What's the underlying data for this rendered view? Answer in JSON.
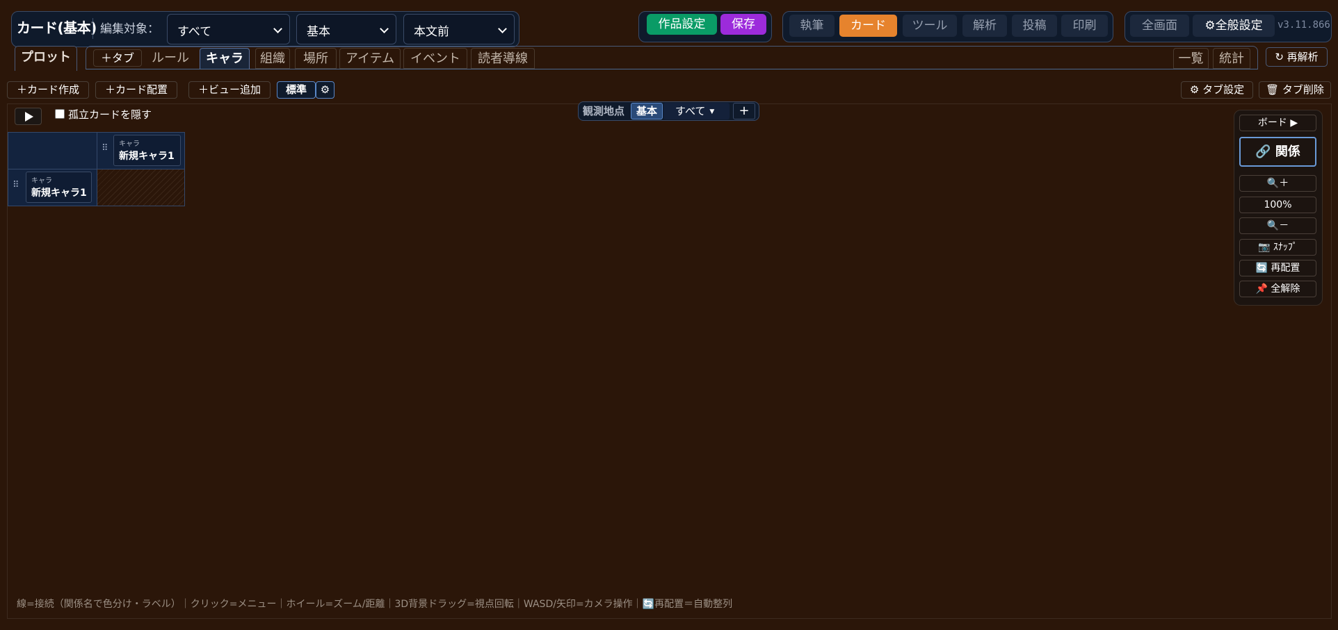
{
  "header": {
    "app_title": "カード(基本)",
    "edit_target_label": "編集対象：",
    "selects": [
      "すべて",
      "基本",
      "本文前"
    ],
    "work_settings": "作品設定",
    "save": "保存",
    "modes": [
      "執筆",
      "カード",
      "ツール",
      "解析",
      "投稿",
      "印刷"
    ],
    "active_mode": "カード",
    "fullscreen": "全画面",
    "general_settings": "⚙全般設定",
    "version": "v3.11.866"
  },
  "tabs": {
    "plot": "プロット",
    "add_tab": "＋タブ",
    "items": [
      "ルール",
      "キャラ",
      "組織",
      "場所",
      "アイテム",
      "イベント",
      "読者導線"
    ],
    "active": "キャラ",
    "list": "一覧",
    "stats": "統計",
    "reparse": "↻ 再解析"
  },
  "toolbar": {
    "create_card": "＋カード作成",
    "place_card": "＋カード配置",
    "add_view": "＋ビュー追加",
    "view_name": "標準",
    "view_gear": "⚙",
    "tab_settings": "⚙ タブ設定",
    "tab_delete": "🗑 タブ削除"
  },
  "canvas": {
    "hide_isolated": "孤立カードを隠す",
    "hide_isolated_checked": false,
    "viewpoint_label": "観測地点",
    "viewpoint_value": "基本",
    "viewpoint_select": "すべて",
    "viewpoint_add": "+",
    "matrix": {
      "col_card": {
        "kind": "キャラ",
        "name": "新規キャラ1"
      },
      "row_card": {
        "kind": "キャラ",
        "name": "新規キャラ1"
      }
    },
    "hint": "線=接続（関係名で色分け・ラベル）｜クリック=メニュー｜ホイール=ズーム/距離｜3D背景ドラッグ=視点回転｜WASD/矢印=カメラ操作｜🔄再配置＝自動整列"
  },
  "side_panel": {
    "board": "ボード ▶",
    "relation": "🔗 関係",
    "zoom_in": "🔍＋",
    "zoom_level": "100%",
    "zoom_out": "🔍－",
    "snap": "📷 ｽﾅｯﾌﾟ",
    "rearrange": "🔄 再配置",
    "unpin_all": "📌 全解除"
  }
}
